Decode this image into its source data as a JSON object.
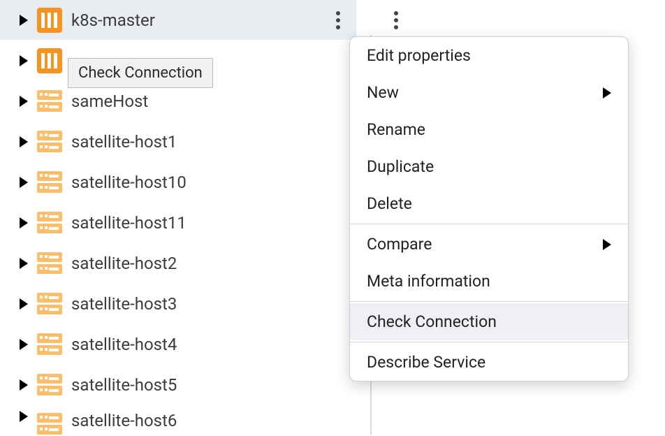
{
  "tree": {
    "items": [
      {
        "label": "k8s-master",
        "icon": "k8s",
        "selected": true,
        "showMore": true
      },
      {
        "label": "",
        "icon": "k8s",
        "selected": false,
        "showMore": false
      },
      {
        "label": "sameHost",
        "icon": "host",
        "selected": false,
        "showMore": false
      },
      {
        "label": "satellite-host1",
        "icon": "host",
        "selected": false,
        "showMore": false
      },
      {
        "label": "satellite-host10",
        "icon": "host",
        "selected": false,
        "showMore": false
      },
      {
        "label": "satellite-host11",
        "icon": "host",
        "selected": false,
        "showMore": false
      },
      {
        "label": "satellite-host2",
        "icon": "host",
        "selected": false,
        "showMore": false
      },
      {
        "label": "satellite-host3",
        "icon": "host",
        "selected": false,
        "showMore": false
      },
      {
        "label": "satellite-host4",
        "icon": "host",
        "selected": false,
        "showMore": false
      },
      {
        "label": "satellite-host5",
        "icon": "host",
        "selected": false,
        "showMore": false
      },
      {
        "label": "satellite-host6",
        "icon": "host",
        "selected": false,
        "showMore": false
      }
    ]
  },
  "tooltip": {
    "text": "Check Connection"
  },
  "context_menu": {
    "groups": [
      [
        {
          "label": "Edit properties",
          "submenu": false,
          "highlighted": false
        },
        {
          "label": "New",
          "submenu": true,
          "highlighted": false
        },
        {
          "label": "Rename",
          "submenu": false,
          "highlighted": false
        },
        {
          "label": "Duplicate",
          "submenu": false,
          "highlighted": false
        },
        {
          "label": "Delete",
          "submenu": false,
          "highlighted": false
        }
      ],
      [
        {
          "label": "Compare",
          "submenu": true,
          "highlighted": false
        },
        {
          "label": "Meta information",
          "submenu": false,
          "highlighted": false
        }
      ],
      [
        {
          "label": "Check Connection",
          "submenu": false,
          "highlighted": true
        }
      ],
      [
        {
          "label": "Describe Service",
          "submenu": false,
          "highlighted": false
        }
      ]
    ]
  }
}
